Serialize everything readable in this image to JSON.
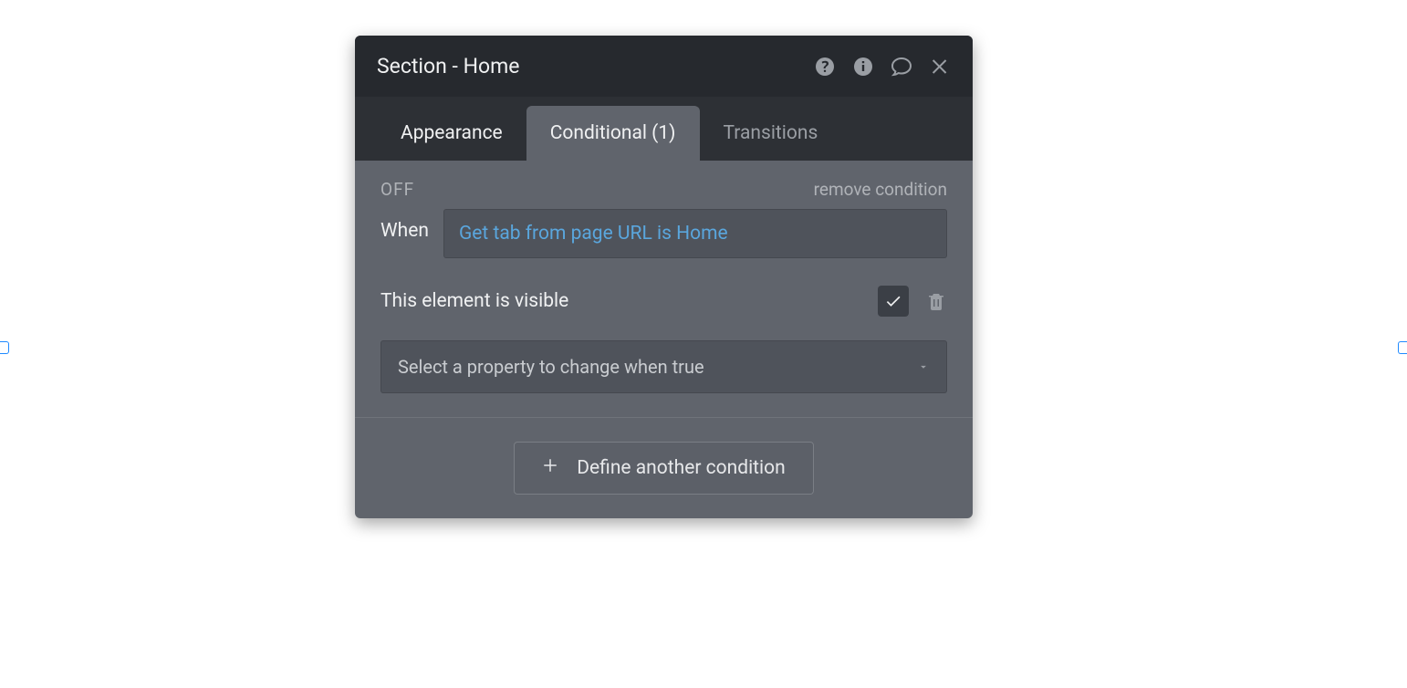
{
  "header": {
    "title": "Section - Home"
  },
  "tabs": {
    "appearance": "Appearance",
    "conditional": "Conditional (1)",
    "transitions": "Transitions"
  },
  "condition": {
    "off_label": "OFF",
    "remove_label": "remove condition",
    "when_label": "When",
    "expression": "Get tab from page URL is Home",
    "visible_label": "This element is visible",
    "select_placeholder": "Select a property to change when true"
  },
  "footer": {
    "define_label": "Define another condition"
  }
}
